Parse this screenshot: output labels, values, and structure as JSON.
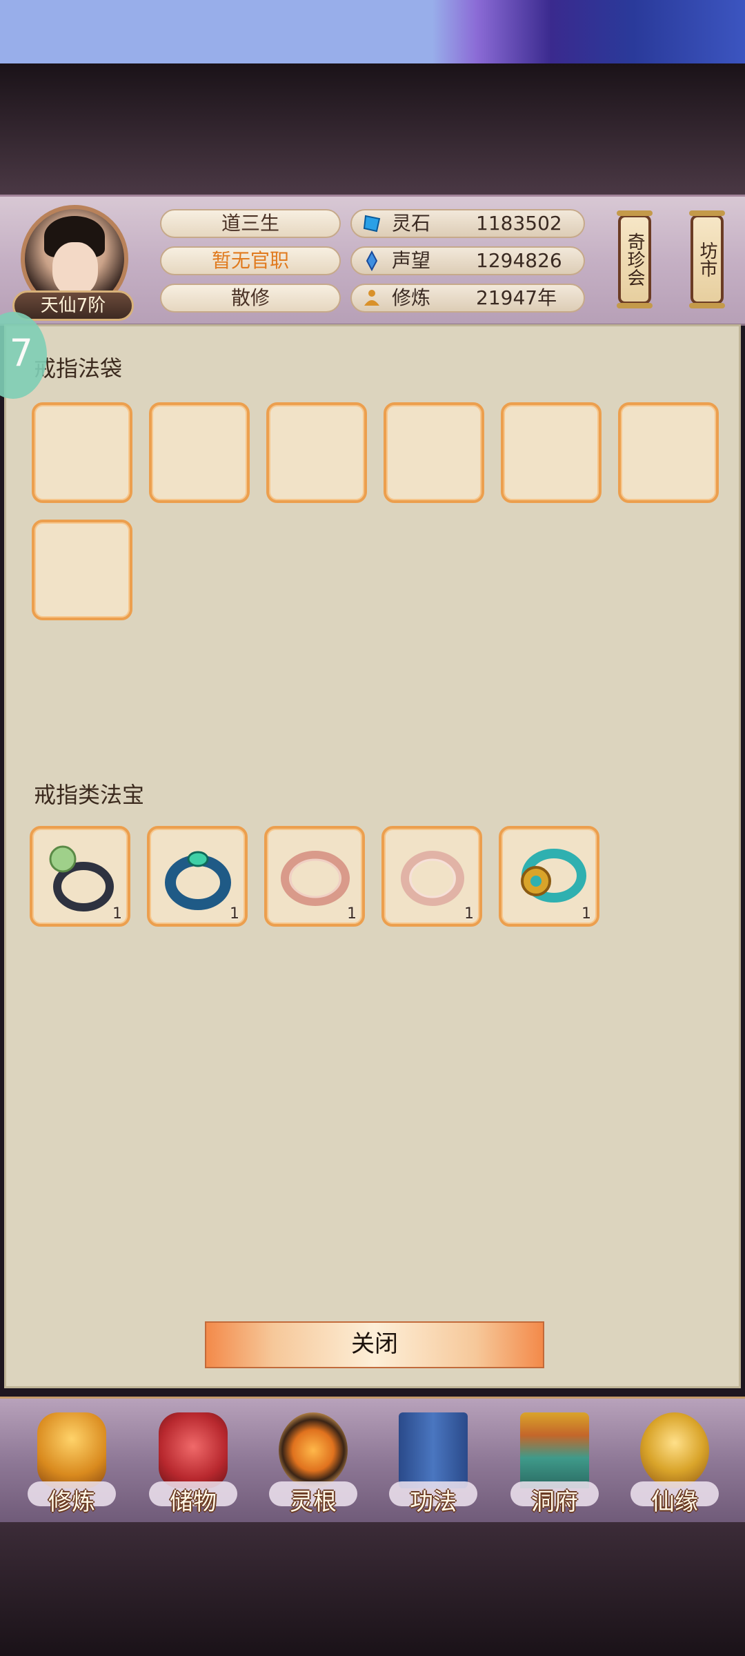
{
  "player": {
    "name": "道三生",
    "office": "暂无官职",
    "faction": "散修",
    "rank": "天仙7阶"
  },
  "resources": [
    {
      "label": "灵石",
      "value": "1183502",
      "icon": "spirit-stone-icon"
    },
    {
      "label": "声望",
      "value": "1294826",
      "icon": "reputation-icon"
    },
    {
      "label": "修炼",
      "value": "21947年",
      "icon": "cultivation-icon"
    }
  ],
  "header_buttons": {
    "treasure_fair": "奇珍会",
    "market": "坊市"
  },
  "sections": {
    "ring_bag": {
      "title": "戒指法袋",
      "slots": 7
    },
    "ring_treasures": {
      "title": "戒指类法宝",
      "items": [
        {
          "icon": "jade-pearl-ring-icon",
          "count": "1"
        },
        {
          "icon": "blue-gem-ring-icon",
          "count": "1"
        },
        {
          "icon": "rose-gold-ring-icon",
          "count": "1"
        },
        {
          "icon": "rose-gold-ring-icon",
          "count": "1"
        },
        {
          "icon": "gold-turquoise-ring-icon",
          "count": "1"
        }
      ]
    }
  },
  "close_label": "关闭",
  "bottom_nav": [
    {
      "label": "修炼",
      "icon": "monk-icon"
    },
    {
      "label": "储物",
      "icon": "pouch-icon"
    },
    {
      "label": "灵根",
      "icon": "triskelion-icon"
    },
    {
      "label": "功法",
      "icon": "book-icon"
    },
    {
      "label": "洞府",
      "icon": "pavilion-icon"
    },
    {
      "label": "仙缘",
      "icon": "gourd-icon"
    }
  ],
  "colors": {
    "slot_border": "#ec9f4e",
    "panel_bg": "#dcd4be",
    "office_text": "#e07a1e"
  }
}
